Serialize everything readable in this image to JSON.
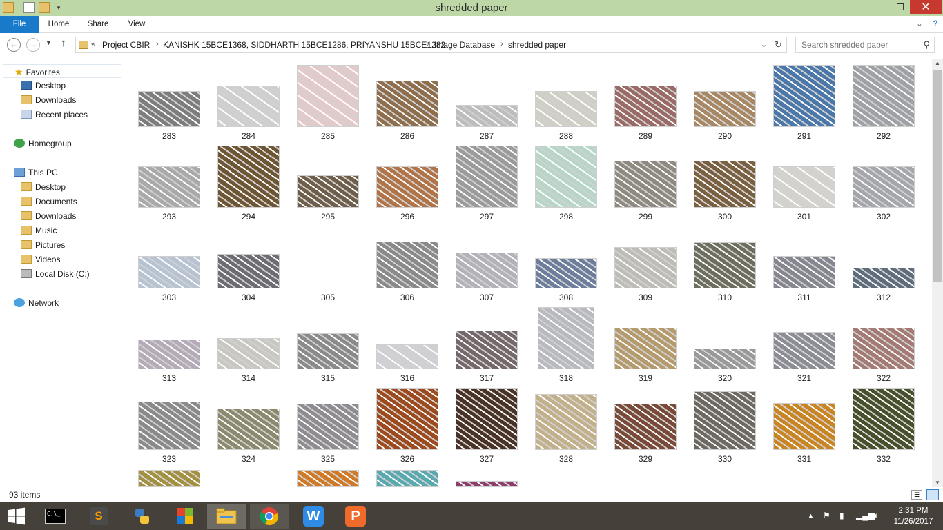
{
  "window": {
    "title": "shredded paper",
    "controls": {
      "minimize": "–",
      "maximize": "❐",
      "close": "✕"
    }
  },
  "ribbon": {
    "tabs": [
      {
        "label": "File",
        "active": true
      },
      {
        "label": "Home"
      },
      {
        "label": "Share"
      },
      {
        "label": "View"
      }
    ]
  },
  "address": {
    "overflow": "«",
    "path": [
      "Project CBIR",
      "KANISHK 15BCE1368, SIDDHARTH 15BCE1286, PRIYANSHU 15BCE1282",
      "Image Database",
      "shredded paper"
    ],
    "search_placeholder": "Search shredded paper"
  },
  "nav": {
    "favorites": {
      "label": "Favorites",
      "items": [
        "Desktop",
        "Downloads",
        "Recent places"
      ]
    },
    "homegroup": "Homegroup",
    "thispc": {
      "label": "This PC",
      "items": [
        "Desktop",
        "Documents",
        "Downloads",
        "Music",
        "Pictures",
        "Videos",
        "Local Disk (C:)"
      ]
    },
    "network": "Network"
  },
  "items": [
    {
      "label": "283",
      "color": "#7d7d7d"
    },
    {
      "label": "284",
      "color": "#cfcfcf"
    },
    {
      "label": "285",
      "color": "#e4c9cb"
    },
    {
      "label": "286",
      "color": "#8e6e4c"
    },
    {
      "label": "287",
      "color": "#bdbdbd"
    },
    {
      "label": "288",
      "color": "#d0cfc6"
    },
    {
      "label": "289",
      "color": "#9a6a66"
    },
    {
      "label": "290",
      "color": "#a88764"
    },
    {
      "label": "291",
      "color": "#4b78a8"
    },
    {
      "label": "292",
      "color": "#9ea1a6"
    },
    {
      "label": "293",
      "color": "#a9a9a9"
    },
    {
      "label": "294",
      "color": "#6e5634"
    },
    {
      "label": "295",
      "color": "#6e5e4a"
    },
    {
      "label": "296",
      "color": "#b07448"
    },
    {
      "label": "297",
      "color": "#9b9b9b"
    },
    {
      "label": "298",
      "color": "#b7d6c8"
    },
    {
      "label": "299",
      "color": "#8f8a80"
    },
    {
      "label": "300",
      "color": "#7a6040"
    },
    {
      "label": "301",
      "color": "#d4d2cc"
    },
    {
      "label": "302",
      "color": "#a5a6ab"
    },
    {
      "label": "303",
      "color": "#b7c3d2"
    },
    {
      "label": "304",
      "color": "#6d6c72"
    },
    {
      "label": "305",
      "color": "#ffffff"
    },
    {
      "label": "306",
      "color": "#8a8a8a"
    },
    {
      "label": "307",
      "color": "#b2b2b8"
    },
    {
      "label": "308",
      "color": "#6d7e9c"
    },
    {
      "label": "309",
      "color": "#bebcb6"
    },
    {
      "label": "310",
      "color": "#6d6e5e"
    },
    {
      "label": "311",
      "color": "#858690"
    },
    {
      "label": "312",
      "color": "#5f6c7c"
    },
    {
      "label": "313",
      "color": "#b5aab8"
    },
    {
      "label": "314",
      "color": "#c9c7c2"
    },
    {
      "label": "315",
      "color": "#8a8a8a"
    },
    {
      "label": "316",
      "color": "#cfcfd4"
    },
    {
      "label": "317",
      "color": "#74686a"
    },
    {
      "label": "318",
      "color": "#b9b9c0"
    },
    {
      "label": "319",
      "color": "#b49a6c"
    },
    {
      "label": "320",
      "color": "#999999"
    },
    {
      "label": "321",
      "color": "#8c8c94"
    },
    {
      "label": "322",
      "color": "#a47a74"
    },
    {
      "label": "323",
      "color": "#8a8a8a"
    },
    {
      "label": "324",
      "color": "#8c8a6e"
    },
    {
      "label": "325",
      "color": "#8e8c90"
    },
    {
      "label": "326",
      "color": "#9c4a1e"
    },
    {
      "label": "327",
      "color": "#4a3326"
    },
    {
      "label": "328",
      "color": "#c2b08a"
    },
    {
      "label": "329",
      "color": "#7a4a38"
    },
    {
      "label": "330",
      "color": "#6e6862"
    },
    {
      "label": "331",
      "color": "#c98424"
    },
    {
      "label": "332",
      "color": "#46502a"
    },
    {
      "label": "",
      "color": "#a39040"
    },
    {
      "label": "",
      "color": "#ffffff"
    },
    {
      "label": "",
      "color": "#d07a28"
    },
    {
      "label": "",
      "color": "#5aa8b0"
    },
    {
      "label": "",
      "color": "#8e3c6a"
    }
  ],
  "status": {
    "count": "93 items"
  },
  "taskbar": {
    "apps": [
      "start",
      "cmd",
      "sublime",
      "python",
      "office",
      "explorer",
      "chrome",
      "wps-writer",
      "wps-presentation"
    ],
    "time": "2:31 PM",
    "date": "11/26/2017"
  }
}
